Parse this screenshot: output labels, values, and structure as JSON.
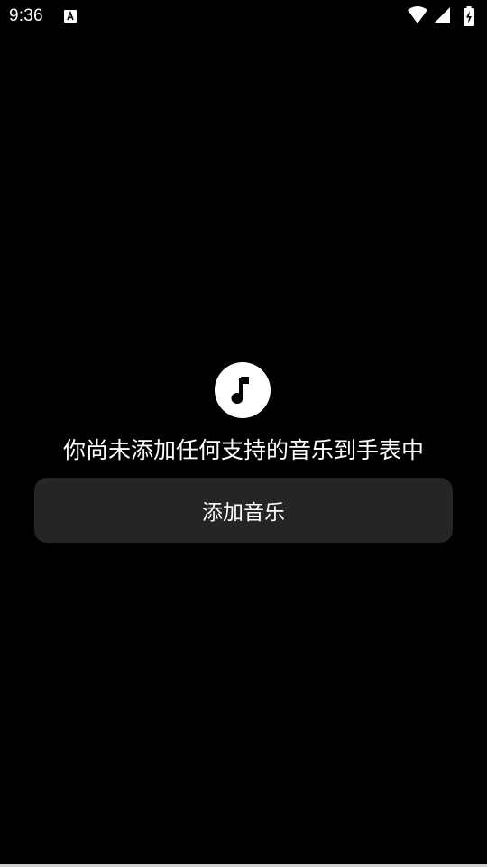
{
  "status_bar": {
    "time": "9:36",
    "notification_icon": "font-a-icon",
    "icons": [
      "wifi-icon",
      "cell-signal-icon",
      "battery-charging-icon"
    ]
  },
  "empty_state": {
    "icon": "music-note-icon",
    "message": "你尚未添加任何支持的音乐到手表中"
  },
  "add_button": {
    "label": "添加音乐"
  },
  "colors": {
    "background": "#000000",
    "button": "#252525",
    "text": "#ffffff"
  }
}
